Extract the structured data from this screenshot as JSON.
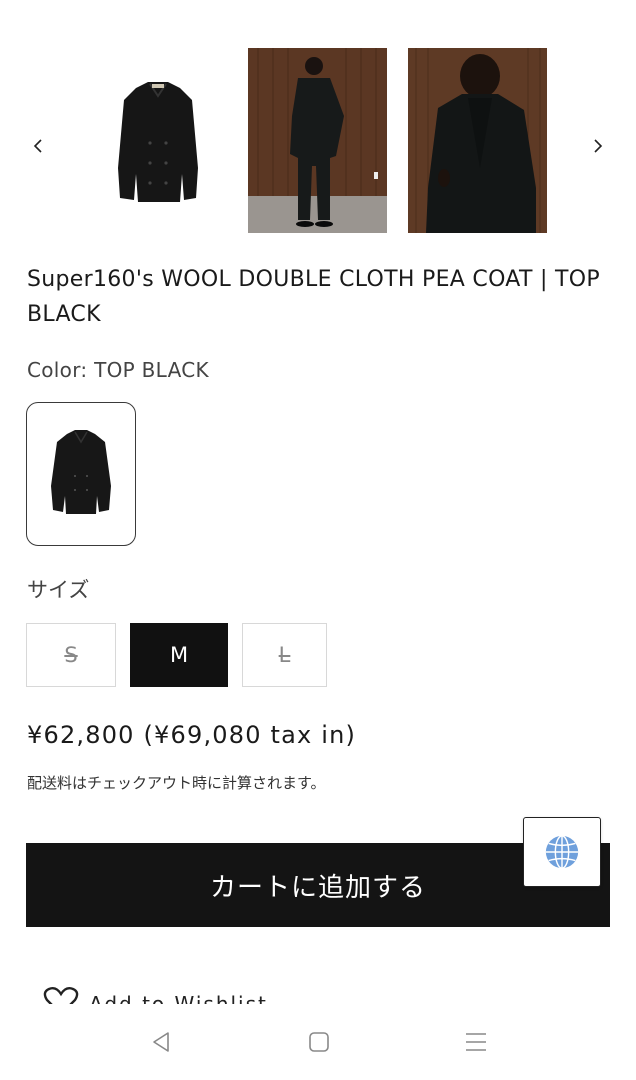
{
  "gallery": {
    "prev_icon": "chevron-left-icon",
    "next_icon": "chevron-right-icon",
    "images": [
      "coat-product-photo",
      "model-full-body-photo",
      "model-closeup-photo"
    ]
  },
  "product": {
    "title": "Super160's WOOL DOUBLE CLOTH PEA COAT | TOP BLACK",
    "color_label": "Color:",
    "color_value": "TOP BLACK"
  },
  "size": {
    "label": "サイズ",
    "options": [
      {
        "label": "S",
        "available": false,
        "selected": false
      },
      {
        "label": "M",
        "available": true,
        "selected": true
      },
      {
        "label": "L",
        "available": false,
        "selected": false
      }
    ]
  },
  "price": {
    "text": "¥62,800 (¥69,080 tax in)"
  },
  "shipping_note": "配送料はチェックアウト時に計算されます。",
  "cart_button": "カートに追加する",
  "wishlist": {
    "label": "Add to Wishlist",
    "icon": "heart-icon"
  },
  "language_widget": {
    "icon": "globe-icon"
  },
  "system_nav": {
    "icons": [
      "back-triangle-icon",
      "home-square-icon",
      "menu-lines-icon"
    ]
  },
  "colors": {
    "primary": "#141414",
    "border": "#d8d8d8",
    "text_muted": "#444444",
    "globe_blue": "#6fa0dc"
  }
}
